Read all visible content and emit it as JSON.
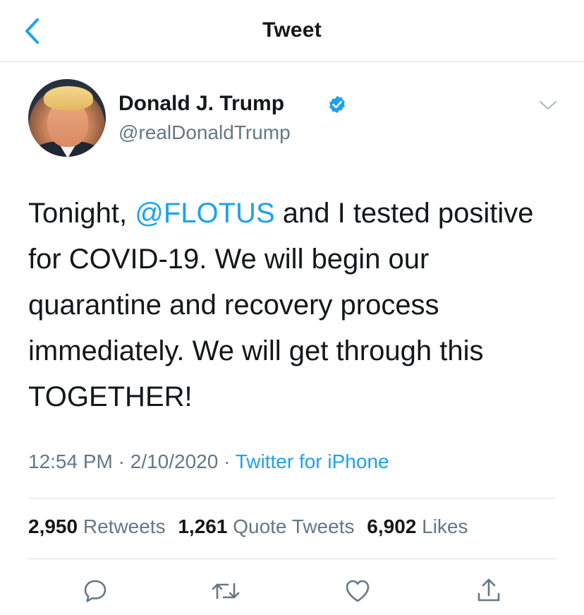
{
  "nav": {
    "title": "Tweet",
    "back_icon": "chevron-left-icon",
    "accent_color": "#1da1f2"
  },
  "author": {
    "display_name": "Donald J. Trump",
    "handle": "@realDonaldTrump",
    "verified_icon": "verified-badge-icon",
    "more_icon": "chevron-down-icon"
  },
  "tweet": {
    "text_before_mention": "Tonight, ",
    "mention": "@FLOTUS",
    "text_after_mention": " and I tested positive for COVID-19. We will begin our quarantine and recovery process immediately. We will get through this TOGETHER!"
  },
  "meta": {
    "time": "12:54 PM",
    "separator": " · ",
    "date": "2/10/2020",
    "source": "Twitter for iPhone"
  },
  "stats": {
    "retweets_count": "2,950",
    "retweets_label": "Retweets",
    "quote_tweets_count": "1,261",
    "quote_tweets_label": "Quote Tweets",
    "likes_count": "6,902",
    "likes_label": "Likes"
  },
  "actions": {
    "reply_icon": "reply-icon",
    "retweet_icon": "retweet-icon",
    "like_icon": "heart-icon",
    "share_icon": "share-icon"
  },
  "colors": {
    "text": "#14171a",
    "secondary": "#657786",
    "link": "#1da1f2",
    "divider": "#d9dde1"
  }
}
